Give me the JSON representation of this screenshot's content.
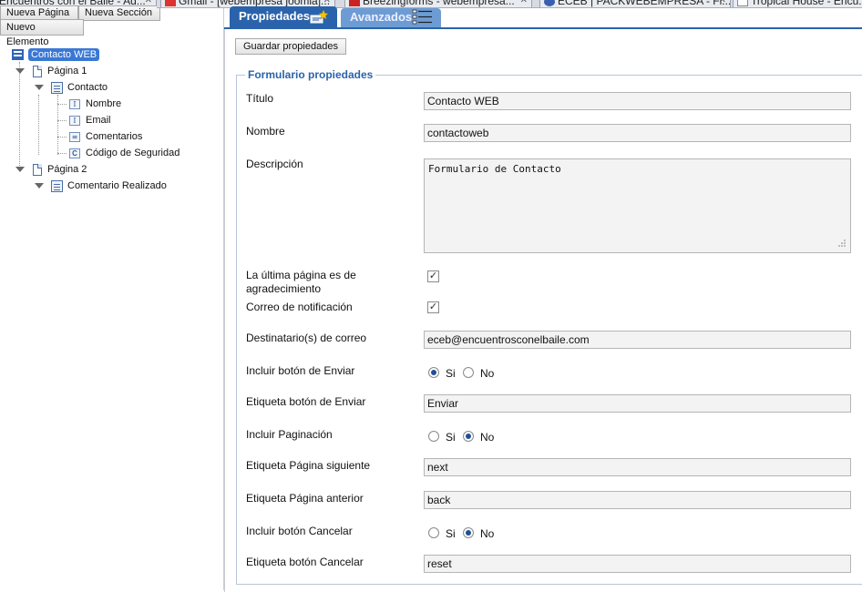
{
  "browser_tabs": [
    {
      "label": "Encuentros con el Baile - Ad..."
    },
    {
      "label": "Gmail - [webempresa joomla]..."
    },
    {
      "label": "Breezingforms - webempresa..."
    },
    {
      "label": "ECEB | PACKWEBEMPRESA - Fi..."
    },
    {
      "label": "Tropical House - Encu..."
    }
  ],
  "left_toolbar": {
    "new_page": "Nueva Página",
    "new_section": "Nueva Sección",
    "new_element": "Nuevo Elemento"
  },
  "tree": {
    "root": "Contacto WEB",
    "pages": [
      {
        "label": "Página 1",
        "sections": [
          {
            "label": "Contacto",
            "fields": [
              {
                "label": "Nombre",
                "icon": "text-field-icon"
              },
              {
                "label": "Email",
                "icon": "text-field-icon"
              },
              {
                "label": "Comentarios",
                "icon": "textarea-field-icon"
              },
              {
                "label": "Código de Seguridad",
                "icon": "captcha-field-icon"
              }
            ]
          }
        ]
      },
      {
        "label": "Página 2",
        "sections": [
          {
            "label": "Comentario Realizado",
            "fields": []
          }
        ]
      }
    ]
  },
  "tabs": {
    "properties": "Propiedades",
    "advanced": "Avanzados"
  },
  "save_button": "Guardar propiedades",
  "form": {
    "legend": "Formulario propiedades",
    "titulo_label": "Título",
    "titulo_value": "Contacto WEB",
    "nombre_label": "Nombre",
    "nombre_value": "contactoweb",
    "descripcion_label": "Descripción",
    "descripcion_value": "Formulario de Contacto",
    "last_page_thanks_label": "La última página es de agradecimiento",
    "last_page_thanks_checked": true,
    "notify_email_label": "Correo de notificación",
    "notify_email_checked": true,
    "recipients_label": "Destinatario(s) de correo",
    "recipients_value": "eceb@encuentrosconelbaile.com",
    "include_send_label": "Incluir botón de Enviar",
    "include_send_value": "Si",
    "send_label_label": "Etiqueta botón de Enviar",
    "send_label_value": "Enviar",
    "include_pagination_label": "Incluir Paginación",
    "include_pagination_value": "No",
    "next_label_label": "Etiqueta Página siguiente",
    "next_label_value": "next",
    "prev_label_label": "Etiqueta Página anterior",
    "prev_label_value": "back",
    "include_cancel_label": "Incluir botón Cancelar",
    "include_cancel_value": "No",
    "cancel_label_label": "Etiqueta botón Cancelar",
    "cancel_label_value": "reset",
    "radio_si": "Si",
    "radio_no": "No"
  },
  "colors": {
    "accent": "#2a63ab",
    "tab_inactive": "#6d9cd4",
    "selected_node": "#3a78d4",
    "input_bg": "#f3f3f3"
  }
}
